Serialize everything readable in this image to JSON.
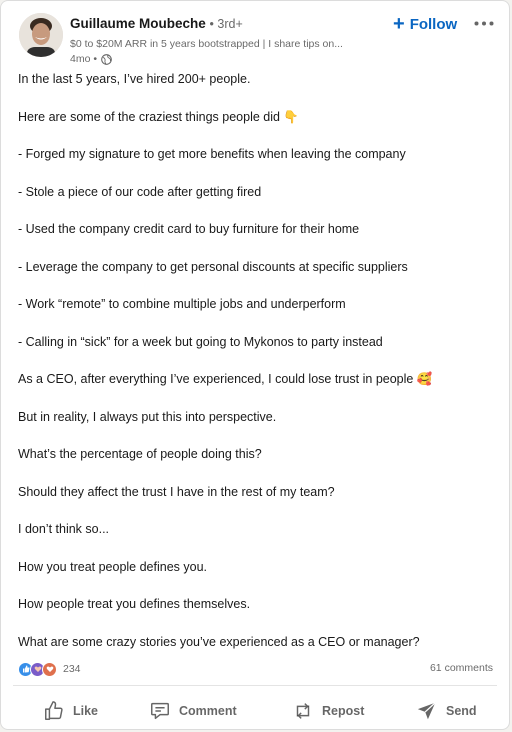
{
  "author": {
    "name": "Guillaume Moubeche",
    "degree": "• 3rd+",
    "headline": "$0 to $20M ARR in 5 years bootstrapped | I share tips on...",
    "time": "4mo •"
  },
  "header": {
    "follow_label": "Follow"
  },
  "post": {
    "lines": [
      "In the last 5 years, I’ve hired 200+ people.",
      "Here are some of the craziest things people did 👇",
      "- Forged my signature to get more benefits when leaving the company",
      "- Stole a piece of our code after getting fired",
      "- Used the company credit card to buy furniture for their home",
      "- Leverage the company to get personal discounts at specific suppliers",
      "- Work “remote” to combine multiple jobs and underperform",
      "- Calling in “sick” for a week but going to Mykonos to party instead",
      "As a CEO, after everything I’ve experienced, I could lose trust in people 🥰",
      "But in reality, I always put this into perspective.",
      "What’s the percentage of people doing this?",
      "Should they affect the trust I have in the rest of my team?",
      "I don’t think so...",
      "How you treat people defines you.",
      "How people treat you defines themselves.",
      "What are some crazy stories you’ve experienced as a CEO or manager?"
    ]
  },
  "social": {
    "reaction_count": "234",
    "comments": "61 comments",
    "reaction_icons": [
      "like-reaction",
      "support-reaction",
      "love-reaction"
    ]
  },
  "actions": {
    "like": "Like",
    "comment": "Comment",
    "repost": "Repost",
    "send": "Send"
  },
  "colors": {
    "link_blue": "#0a66c2",
    "like_blue": "#378fe9",
    "support_purple": "#7a5cc8",
    "love_red": "#df704d"
  }
}
